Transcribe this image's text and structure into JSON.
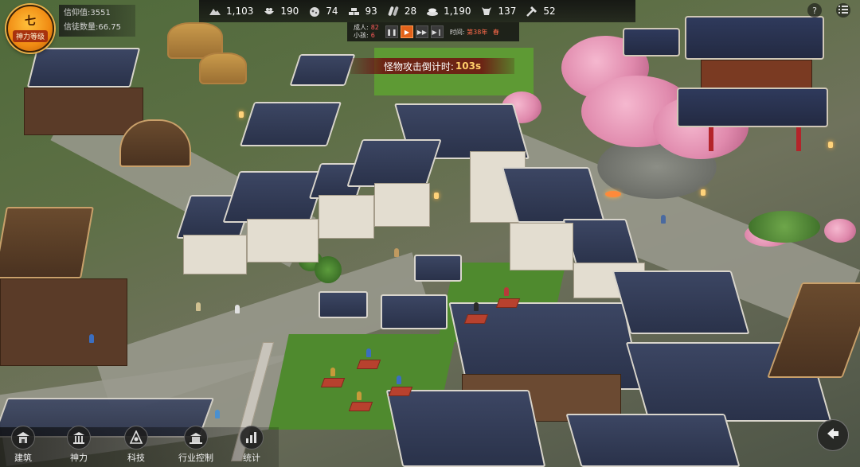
{
  "faith_badge": {
    "glyph": "七",
    "label": "神力等级"
  },
  "faith_stats": {
    "belief": "信仰值:3551",
    "believers": "信徒数量:66.75"
  },
  "resources": [
    {
      "icon": "stone-pile-icon",
      "value": "1,103"
    },
    {
      "icon": "food-bowl-icon",
      "value": "190"
    },
    {
      "icon": "ore-icon",
      "value": "74"
    },
    {
      "icon": "bricks-icon",
      "value": "93"
    },
    {
      "icon": "lumber-icon",
      "value": "28"
    },
    {
      "icon": "coins-icon",
      "value": "1,190"
    },
    {
      "icon": "ox-head-icon",
      "value": "137"
    },
    {
      "icon": "tools-icon",
      "value": "52"
    }
  ],
  "population": {
    "adults_label": "成人:",
    "adults": "82",
    "children_label": "小孩:",
    "children": "6"
  },
  "speed_controls": [
    {
      "icon": "pause-icon",
      "active": false
    },
    {
      "icon": "play-icon",
      "active": true
    },
    {
      "icon": "fast-forward-icon",
      "active": false
    },
    {
      "icon": "skip-forward-icon",
      "active": false
    }
  ],
  "time": {
    "label": "时间:",
    "year": "第38年",
    "season": "春"
  },
  "countdown": {
    "label": "怪物攻击倒计时:",
    "time": "103s"
  },
  "menu": [
    {
      "icon": "building-icon",
      "label": "建筑"
    },
    {
      "icon": "deity-icon",
      "label": "神力"
    },
    {
      "icon": "tech-tree-icon",
      "label": "科技"
    },
    {
      "icon": "industry-icon",
      "label": "行业控制"
    },
    {
      "icon": "statistics-icon",
      "label": "统计"
    }
  ],
  "colors": {
    "accent": "#e2621a",
    "countdown_bg": "#6e0f0f",
    "alert_number": "#ff5a5a",
    "badge": "#f08a12"
  }
}
